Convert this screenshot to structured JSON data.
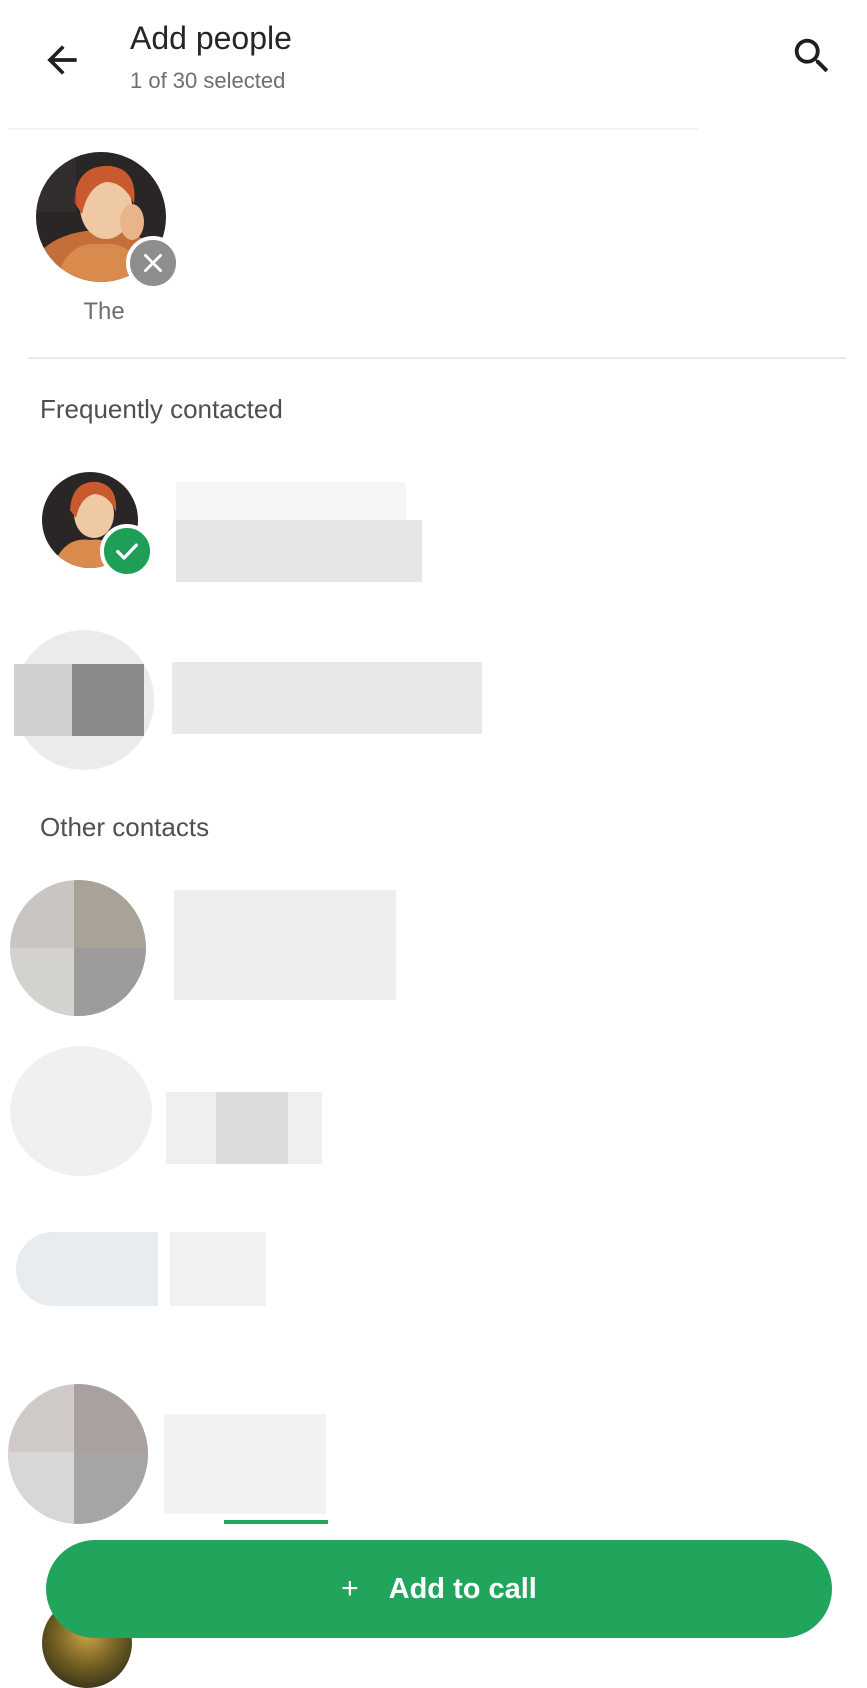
{
  "header": {
    "title": "Add people",
    "subtitle": "1 of 30 selected"
  },
  "icons": {
    "back": "arrow-back-icon",
    "search": "search-icon",
    "remove": "close-icon",
    "selected": "check-icon",
    "add": "plus-icon"
  },
  "selected": [
    {
      "name": "The"
    }
  ],
  "sections": {
    "frequent": "Frequently contacted",
    "other": "Other contacts"
  },
  "actions": {
    "add_label": "Add to call",
    "add_icon": "+"
  },
  "colors": {
    "accent": "#21a55d",
    "check": "#1e9e56",
    "remove_badge": "#8e8e8e"
  }
}
